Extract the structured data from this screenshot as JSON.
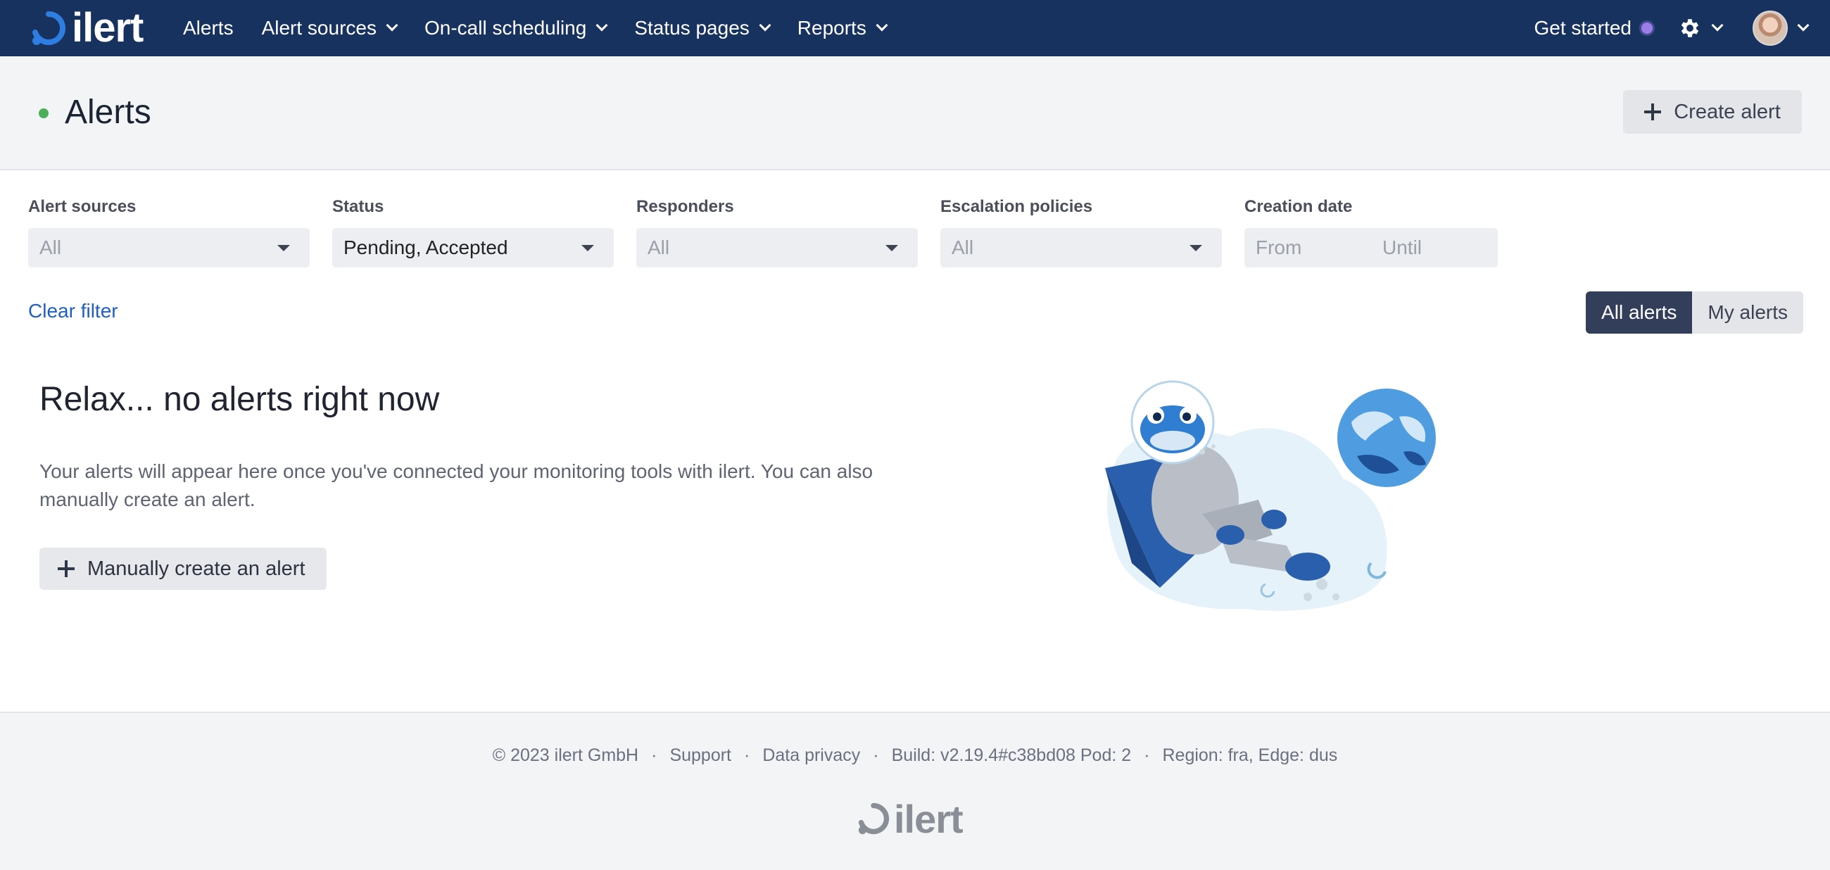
{
  "brand": {
    "name": "ilert"
  },
  "nav": {
    "items": [
      {
        "label": "Alerts",
        "has_dropdown": false
      },
      {
        "label": "Alert sources",
        "has_dropdown": true
      },
      {
        "label": "On-call scheduling",
        "has_dropdown": true
      },
      {
        "label": "Status pages",
        "has_dropdown": true
      },
      {
        "label": "Reports",
        "has_dropdown": true
      }
    ],
    "get_started": "Get started"
  },
  "header": {
    "title": "Alerts",
    "create_button": "Create alert"
  },
  "filters": {
    "alert_sources": {
      "label": "Alert sources",
      "value": "All"
    },
    "status": {
      "label": "Status",
      "value": "Pending, Accepted"
    },
    "responders": {
      "label": "Responders",
      "value": "All"
    },
    "escalation_policies": {
      "label": "Escalation policies",
      "value": "All"
    },
    "creation_date": {
      "label": "Creation date",
      "from_placeholder": "From",
      "until_placeholder": "Until"
    },
    "clear": "Clear filter"
  },
  "view_toggle": {
    "all": "All alerts",
    "mine": "My alerts",
    "selected": "All alerts"
  },
  "empty_state": {
    "title": "Relax... no alerts right now",
    "description": "Your alerts will appear here once you've connected your monitoring tools with ilert. You can also manually create an alert.",
    "button": "Manually create an alert"
  },
  "footer": {
    "copyright": "© 2023 ilert GmbH",
    "support": "Support",
    "privacy": "Data privacy",
    "build": "Build: v2.19.4#c38bd08 Pod: 2",
    "region": "Region: fra, Edge: dus",
    "logo_text": "ilert"
  },
  "colors": {
    "navbar": "#17325e",
    "accent_link": "#1f5fc0",
    "status_dot": "#4cae58",
    "toggle_active": "#323e5a",
    "get_started_dot": "#9b7ee8"
  }
}
